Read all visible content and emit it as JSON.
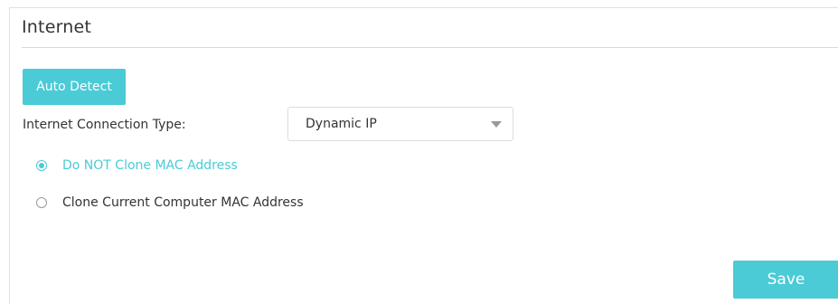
{
  "panel": {
    "title": "Internet"
  },
  "auto_detect": {
    "label": "Auto Detect"
  },
  "connection_type": {
    "label": "Internet Connection Type:",
    "selected": "Dynamic IP"
  },
  "mac_clone": {
    "options": [
      {
        "label": "Do NOT Clone MAC Address",
        "checked": true
      },
      {
        "label": "Clone Current Computer MAC Address",
        "checked": false
      }
    ]
  },
  "actions": {
    "save_label": "Save"
  },
  "colors": {
    "accent": "#4acbd6",
    "text": "#333333",
    "border": "#dcdcdc"
  },
  "icons": {
    "dropdown": "chevron-down-icon"
  }
}
